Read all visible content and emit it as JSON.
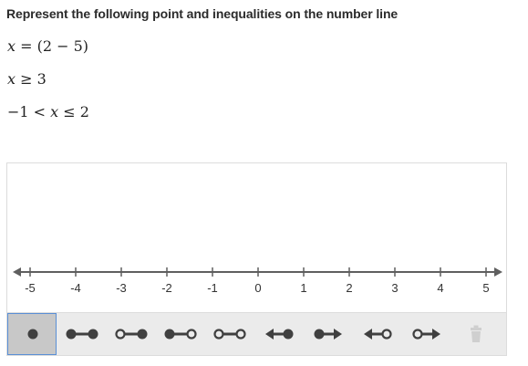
{
  "prompt": "Represent the following point and inequalities on the number line",
  "equations": [
    {
      "var": "x",
      "rest": " = (2 − 5)"
    },
    {
      "var": "x",
      "rest": " ≥ 3"
    },
    {
      "pre": "−1 < ",
      "var": "x",
      "rest": " ≤ 2"
    }
  ],
  "number_line": {
    "min": -5,
    "max": 5,
    "ticks": [
      "-5",
      "-4",
      "-3",
      "-2",
      "-1",
      "0",
      "1",
      "2",
      "3",
      "4",
      "5"
    ]
  },
  "tools": [
    {
      "name": "point-tool",
      "icon": "closed-point-icon",
      "selected": true
    },
    {
      "name": "closed-closed-segment-tool",
      "icon": "closed-closed-segment-icon"
    },
    {
      "name": "open-closed-segment-tool",
      "icon": "open-closed-segment-icon"
    },
    {
      "name": "closed-open-segment-tool",
      "icon": "closed-open-segment-icon"
    },
    {
      "name": "open-open-segment-tool",
      "icon": "open-open-segment-icon"
    },
    {
      "name": "left-ray-closed-tool",
      "icon": "left-ray-closed-icon"
    },
    {
      "name": "right-ray-closed-tool",
      "icon": "right-ray-closed-icon"
    },
    {
      "name": "left-ray-open-tool",
      "icon": "left-ray-open-icon"
    },
    {
      "name": "right-ray-open-tool",
      "icon": "right-ray-open-icon"
    },
    {
      "name": "delete-tool",
      "icon": "trash-icon",
      "disabled": true
    }
  ],
  "colors": {
    "line": "#5f5f5f",
    "icon": "#404040",
    "selected_border": "#5a8fd6",
    "disabled_icon": "#cfcfcf"
  }
}
